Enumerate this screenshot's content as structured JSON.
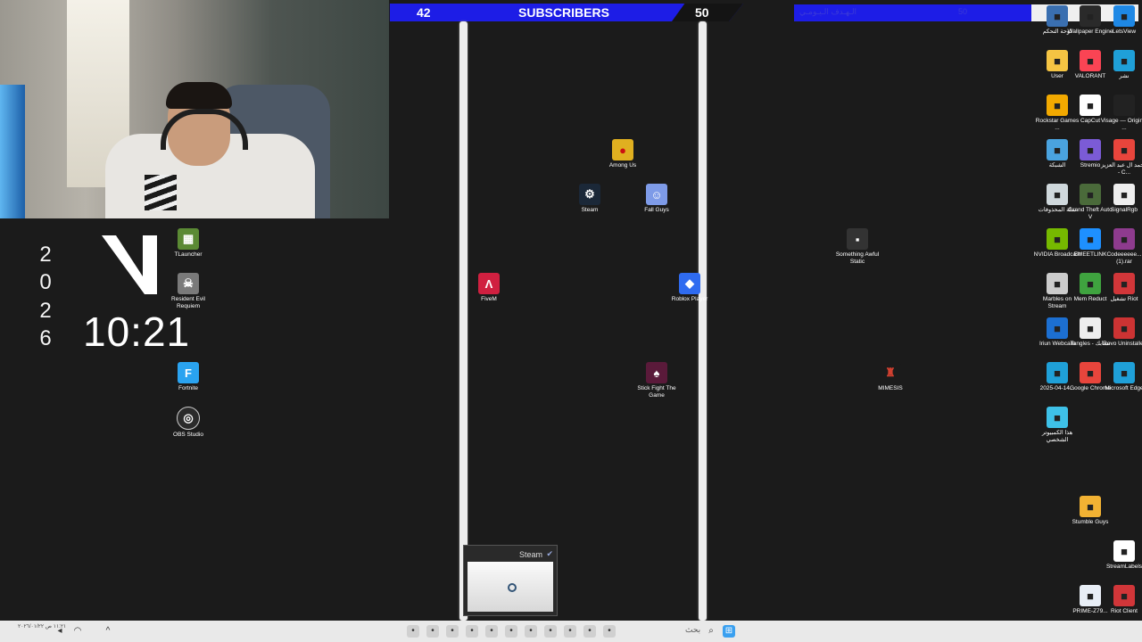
{
  "subscribers": {
    "current": "42",
    "label": "SUBSCRIBERS",
    "goal": "50"
  },
  "goal_bar": {
    "faint_left": "الـهـدف الـيـومـي",
    "faint_mid": "50",
    "max": "100"
  },
  "clock_widget": {
    "year_digits": [
      "2",
      "0",
      "2",
      "6"
    ],
    "time": "10:21"
  },
  "desktop_left": [
    {
      "label": "TLauncher",
      "icon": "minecraft-icon",
      "color": "#5b8a34"
    },
    {
      "label": "Resident Evil Requiem",
      "icon": "resident-evil-icon",
      "color": "#7a7a7a"
    },
    {
      "label": "Fortnite",
      "icon": "fortnite-icon",
      "color": "#2aa3f0"
    },
    {
      "label": "OBS Studio",
      "icon": "obs-icon",
      "color": "#2b2b2b"
    }
  ],
  "desktop_center": [
    {
      "label": "Among Us",
      "icon": "among-us-icon",
      "color": "#e0b020"
    },
    {
      "label": "Steam",
      "icon": "steam-icon",
      "color": "#1b2838"
    },
    {
      "label": "Fall Guys",
      "icon": "fall-guys-icon",
      "color": "#7e9be8"
    },
    {
      "label": "FiveM",
      "icon": "fivem-icon",
      "color": "#d02040"
    },
    {
      "label": "Roblox Player",
      "icon": "roblox-icon",
      "color": "#2f6bf0"
    },
    {
      "label": "Stick Fight The Game",
      "icon": "stick-fight-icon",
      "color": "#5a1a3a"
    },
    {
      "label": "Something Awful Static",
      "icon": "static-icon",
      "color": "#333333"
    },
    {
      "label": "MIMESIS",
      "icon": "mimesis-icon",
      "color": "#b03020"
    }
  ],
  "desktop_right": [
    {
      "label": "لوحة التحكم",
      "icon": "control-panel-icon",
      "color": "#3a6fb0"
    },
    {
      "label": "Wallpaper Engine",
      "icon": "wallpaper-engine-icon",
      "color": "#2a2a2a"
    },
    {
      "label": "LetsView",
      "icon": "letsview-icon",
      "color": "#1e88e5"
    },
    {
      "label": "User",
      "icon": "folder-icon",
      "color": "#f5c443"
    },
    {
      "label": "VALORANT",
      "icon": "valorant-icon",
      "color": "#fa4454"
    },
    {
      "label": "نشر",
      "icon": "edge-icon",
      "color": "#1fa0d8"
    },
    {
      "label": "Rockstar Games ...",
      "icon": "rockstar-icon",
      "color": "#f2a900"
    },
    {
      "label": "CapCut",
      "icon": "capcut-icon",
      "color": "#ffffff"
    },
    {
      "label": "Visage — Original ...",
      "icon": "visage-icon",
      "color": "#222222"
    },
    {
      "label": "الشبكة",
      "icon": "network-icon",
      "color": "#4aa3df"
    },
    {
      "label": "Stremio",
      "icon": "stremio-icon",
      "color": "#7b5bd6"
    },
    {
      "label": "محمد ال عبد العزيز - C...",
      "icon": "chrome-icon",
      "color": "#e8453c"
    },
    {
      "label": "سلة المحذوفات",
      "icon": "recycle-bin-icon",
      "color": "#cfd8dc"
    },
    {
      "label": "Grand Theft Auto V",
      "icon": "gta-icon",
      "color": "#4a6a3a"
    },
    {
      "label": "SignalRgb",
      "icon": "signalrgb-icon",
      "color": "#eeeeee"
    },
    {
      "label": "NVIDIA Broadcast",
      "icon": "nvidia-icon",
      "color": "#76b900"
    },
    {
      "label": "EMEETLINK",
      "icon": "emeet-icon",
      "color": "#1e90ff"
    },
    {
      "label": "Codeeeeee... (1).rar",
      "icon": "winrar-icon",
      "color": "#8e3b8e"
    },
    {
      "label": "Marbles on Stream",
      "icon": "marbles-icon",
      "color": "#cccccc"
    },
    {
      "label": "Mem Reduct",
      "icon": "mem-reduct-icon",
      "color": "#3fa33f"
    },
    {
      "label": "تشغيل Riot",
      "icon": "riot-icon",
      "color": "#d13639"
    },
    {
      "label": "Iriun Webcam",
      "icon": "iriun-icon",
      "color": "#1c6fd1"
    },
    {
      "label": "Tangles - تشابك",
      "icon": "tangles-icon",
      "color": "#eeeeee"
    },
    {
      "label": "Revo Uninstaller",
      "icon": "revo-icon",
      "color": "#cc3333"
    },
    {
      "label": "2025-04-14...",
      "icon": "edge-icon",
      "color": "#1fa0d8"
    },
    {
      "label": "Google Chrome",
      "icon": "chrome-icon",
      "color": "#e8453c"
    },
    {
      "label": "Microsoft Edge",
      "icon": "edge-icon",
      "color": "#1fa0d8"
    },
    {
      "label": "هذا الكمبيوتر الشخصي",
      "icon": "this-pc-icon",
      "color": "#3ec1e8"
    },
    {
      "label": "Stumble Guys",
      "icon": "stumble-guys-icon",
      "color": "#f2b233"
    },
    {
      "label": "StreamLabels",
      "icon": "streamlabels-icon",
      "color": "#ffffff"
    },
    {
      "label": "PRIME-Z79...",
      "icon": "document-icon",
      "color": "#e8eef6"
    },
    {
      "label": "Riot Client",
      "icon": "riot-icon",
      "color": "#d13639"
    }
  ],
  "steam_popup": {
    "title": "Steam"
  },
  "taskbar": {
    "search": "بحث",
    "date": "١١:٢١ ص\n٢٠٢٦/٠١/٢٢",
    "apps": [
      "chrome-icon",
      "obs-icon",
      "chrome-icon",
      "discord-icon",
      "steam-icon",
      "settings-icon",
      "edge-icon",
      "file-explorer-icon",
      "notepad-icon",
      "calendar-icon",
      "photo-icon"
    ]
  }
}
